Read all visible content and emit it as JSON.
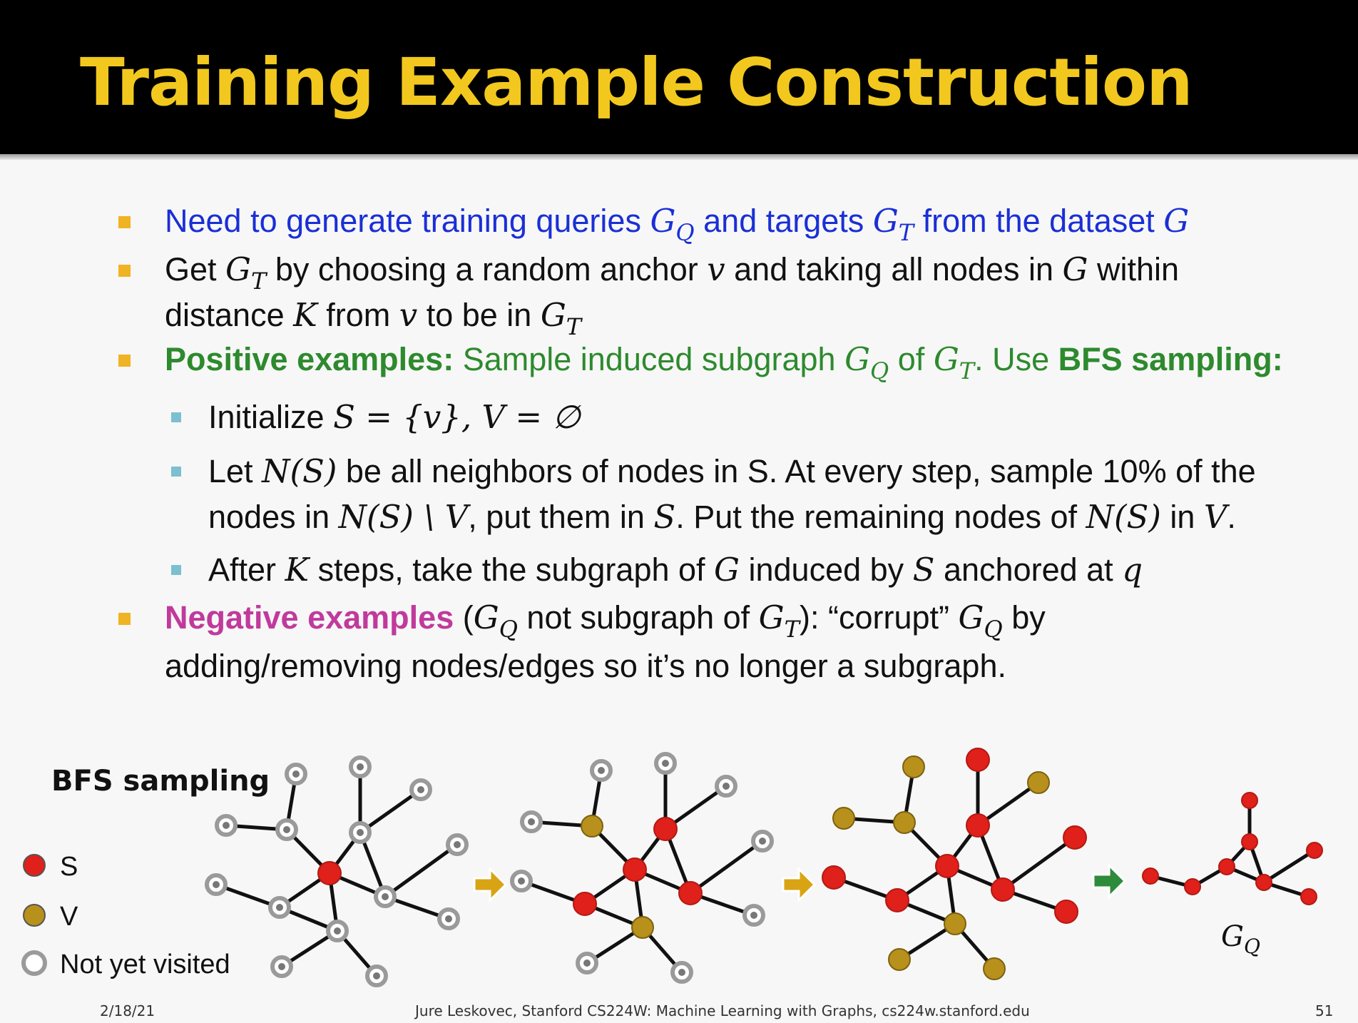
{
  "title": "Training Example Construction",
  "bullets": [
    {
      "parts": [
        "Need to generate training queries ",
        "G",
        "Q",
        " and targets ",
        "G",
        "T",
        " from the dataset ",
        "G"
      ]
    },
    {
      "line1": [
        "Get ",
        "G",
        "T",
        " by choosing a random anchor ",
        "v",
        " and taking all nodes in ",
        "G",
        " within"
      ],
      "line2": [
        "distance ",
        "K",
        " from ",
        "v",
        " to be in ",
        "G",
        "T"
      ]
    },
    {
      "parts": [
        "Positive examples:",
        " Sample induced subgraph ",
        "G",
        "Q",
        " of ",
        "G",
        "T",
        ". Use ",
        "BFS sampling:"
      ]
    },
    {
      "parts": [
        "Initialize ",
        "S = {v}, V = ∅"
      ]
    },
    {
      "line1": [
        "Let ",
        "N(S)",
        " be all neighbors of nodes in S. At every step, sample 10% of the"
      ],
      "line2": [
        "nodes in ",
        "N(S) \\ V",
        ", put them in ",
        "S",
        ". Put the remaining nodes of ",
        "N(S)",
        " in ",
        "V",
        "."
      ]
    },
    {
      "parts": [
        "After ",
        "K",
        " steps, take the subgraph of ",
        "G",
        " induced by ",
        "S",
        " anchored at ",
        "q"
      ]
    },
    {
      "line1": [
        "Negative examples",
        " (",
        "G",
        "Q",
        " not subgraph of ",
        "G",
        "T",
        "): “corrupt” ",
        "G",
        "Q",
        " by"
      ],
      "line2": [
        "adding/removing nodes/edges so it’s no longer a subgraph."
      ]
    }
  ],
  "diagram": {
    "heading": "BFS sampling",
    "legend": [
      {
        "label": "S",
        "color": "#e0201a"
      },
      {
        "label": "V",
        "color": "#b8901c"
      },
      {
        "label": "Not yet visited",
        "color": "#9a9a9a"
      }
    ],
    "result_label": "G",
    "result_sub": "Q",
    "arrow_colors": [
      "#d9a414",
      "#d9a414",
      "#2e8b3a"
    ]
  },
  "footer": {
    "date": "2/18/21",
    "credit": "Jure Leskovec, Stanford CS224W: Machine Learning with Graphs, cs224w.stanford.edu",
    "page": "51"
  }
}
